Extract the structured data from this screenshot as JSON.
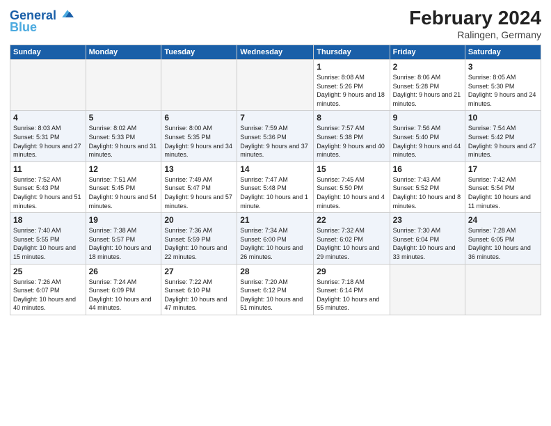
{
  "header": {
    "logo_line1": "General",
    "logo_line2": "Blue",
    "month_title": "February 2024",
    "location": "Ralingen, Germany"
  },
  "days_of_week": [
    "Sunday",
    "Monday",
    "Tuesday",
    "Wednesday",
    "Thursday",
    "Friday",
    "Saturday"
  ],
  "weeks": [
    [
      {
        "num": "",
        "empty": true
      },
      {
        "num": "",
        "empty": true
      },
      {
        "num": "",
        "empty": true
      },
      {
        "num": "",
        "empty": true
      },
      {
        "num": "1",
        "sunrise": "8:08 AM",
        "sunset": "5:26 PM",
        "daylight": "9 hours and 18 minutes."
      },
      {
        "num": "2",
        "sunrise": "8:06 AM",
        "sunset": "5:28 PM",
        "daylight": "9 hours and 21 minutes."
      },
      {
        "num": "3",
        "sunrise": "8:05 AM",
        "sunset": "5:30 PM",
        "daylight": "9 hours and 24 minutes."
      }
    ],
    [
      {
        "num": "4",
        "sunrise": "8:03 AM",
        "sunset": "5:31 PM",
        "daylight": "9 hours and 27 minutes."
      },
      {
        "num": "5",
        "sunrise": "8:02 AM",
        "sunset": "5:33 PM",
        "daylight": "9 hours and 31 minutes."
      },
      {
        "num": "6",
        "sunrise": "8:00 AM",
        "sunset": "5:35 PM",
        "daylight": "9 hours and 34 minutes."
      },
      {
        "num": "7",
        "sunrise": "7:59 AM",
        "sunset": "5:36 PM",
        "daylight": "9 hours and 37 minutes."
      },
      {
        "num": "8",
        "sunrise": "7:57 AM",
        "sunset": "5:38 PM",
        "daylight": "9 hours and 40 minutes."
      },
      {
        "num": "9",
        "sunrise": "7:56 AM",
        "sunset": "5:40 PM",
        "daylight": "9 hours and 44 minutes."
      },
      {
        "num": "10",
        "sunrise": "7:54 AM",
        "sunset": "5:42 PM",
        "daylight": "9 hours and 47 minutes."
      }
    ],
    [
      {
        "num": "11",
        "sunrise": "7:52 AM",
        "sunset": "5:43 PM",
        "daylight": "9 hours and 51 minutes."
      },
      {
        "num": "12",
        "sunrise": "7:51 AM",
        "sunset": "5:45 PM",
        "daylight": "9 hours and 54 minutes."
      },
      {
        "num": "13",
        "sunrise": "7:49 AM",
        "sunset": "5:47 PM",
        "daylight": "9 hours and 57 minutes."
      },
      {
        "num": "14",
        "sunrise": "7:47 AM",
        "sunset": "5:48 PM",
        "daylight": "10 hours and 1 minute."
      },
      {
        "num": "15",
        "sunrise": "7:45 AM",
        "sunset": "5:50 PM",
        "daylight": "10 hours and 4 minutes."
      },
      {
        "num": "16",
        "sunrise": "7:43 AM",
        "sunset": "5:52 PM",
        "daylight": "10 hours and 8 minutes."
      },
      {
        "num": "17",
        "sunrise": "7:42 AM",
        "sunset": "5:54 PM",
        "daylight": "10 hours and 11 minutes."
      }
    ],
    [
      {
        "num": "18",
        "sunrise": "7:40 AM",
        "sunset": "5:55 PM",
        "daylight": "10 hours and 15 minutes."
      },
      {
        "num": "19",
        "sunrise": "7:38 AM",
        "sunset": "5:57 PM",
        "daylight": "10 hours and 18 minutes."
      },
      {
        "num": "20",
        "sunrise": "7:36 AM",
        "sunset": "5:59 PM",
        "daylight": "10 hours and 22 minutes."
      },
      {
        "num": "21",
        "sunrise": "7:34 AM",
        "sunset": "6:00 PM",
        "daylight": "10 hours and 26 minutes."
      },
      {
        "num": "22",
        "sunrise": "7:32 AM",
        "sunset": "6:02 PM",
        "daylight": "10 hours and 29 minutes."
      },
      {
        "num": "23",
        "sunrise": "7:30 AM",
        "sunset": "6:04 PM",
        "daylight": "10 hours and 33 minutes."
      },
      {
        "num": "24",
        "sunrise": "7:28 AM",
        "sunset": "6:05 PM",
        "daylight": "10 hours and 36 minutes."
      }
    ],
    [
      {
        "num": "25",
        "sunrise": "7:26 AM",
        "sunset": "6:07 PM",
        "daylight": "10 hours and 40 minutes."
      },
      {
        "num": "26",
        "sunrise": "7:24 AM",
        "sunset": "6:09 PM",
        "daylight": "10 hours and 44 minutes."
      },
      {
        "num": "27",
        "sunrise": "7:22 AM",
        "sunset": "6:10 PM",
        "daylight": "10 hours and 47 minutes."
      },
      {
        "num": "28",
        "sunrise": "7:20 AM",
        "sunset": "6:12 PM",
        "daylight": "10 hours and 51 minutes."
      },
      {
        "num": "29",
        "sunrise": "7:18 AM",
        "sunset": "6:14 PM",
        "daylight": "10 hours and 55 minutes."
      },
      {
        "num": "",
        "empty": true
      },
      {
        "num": "",
        "empty": true
      }
    ]
  ]
}
